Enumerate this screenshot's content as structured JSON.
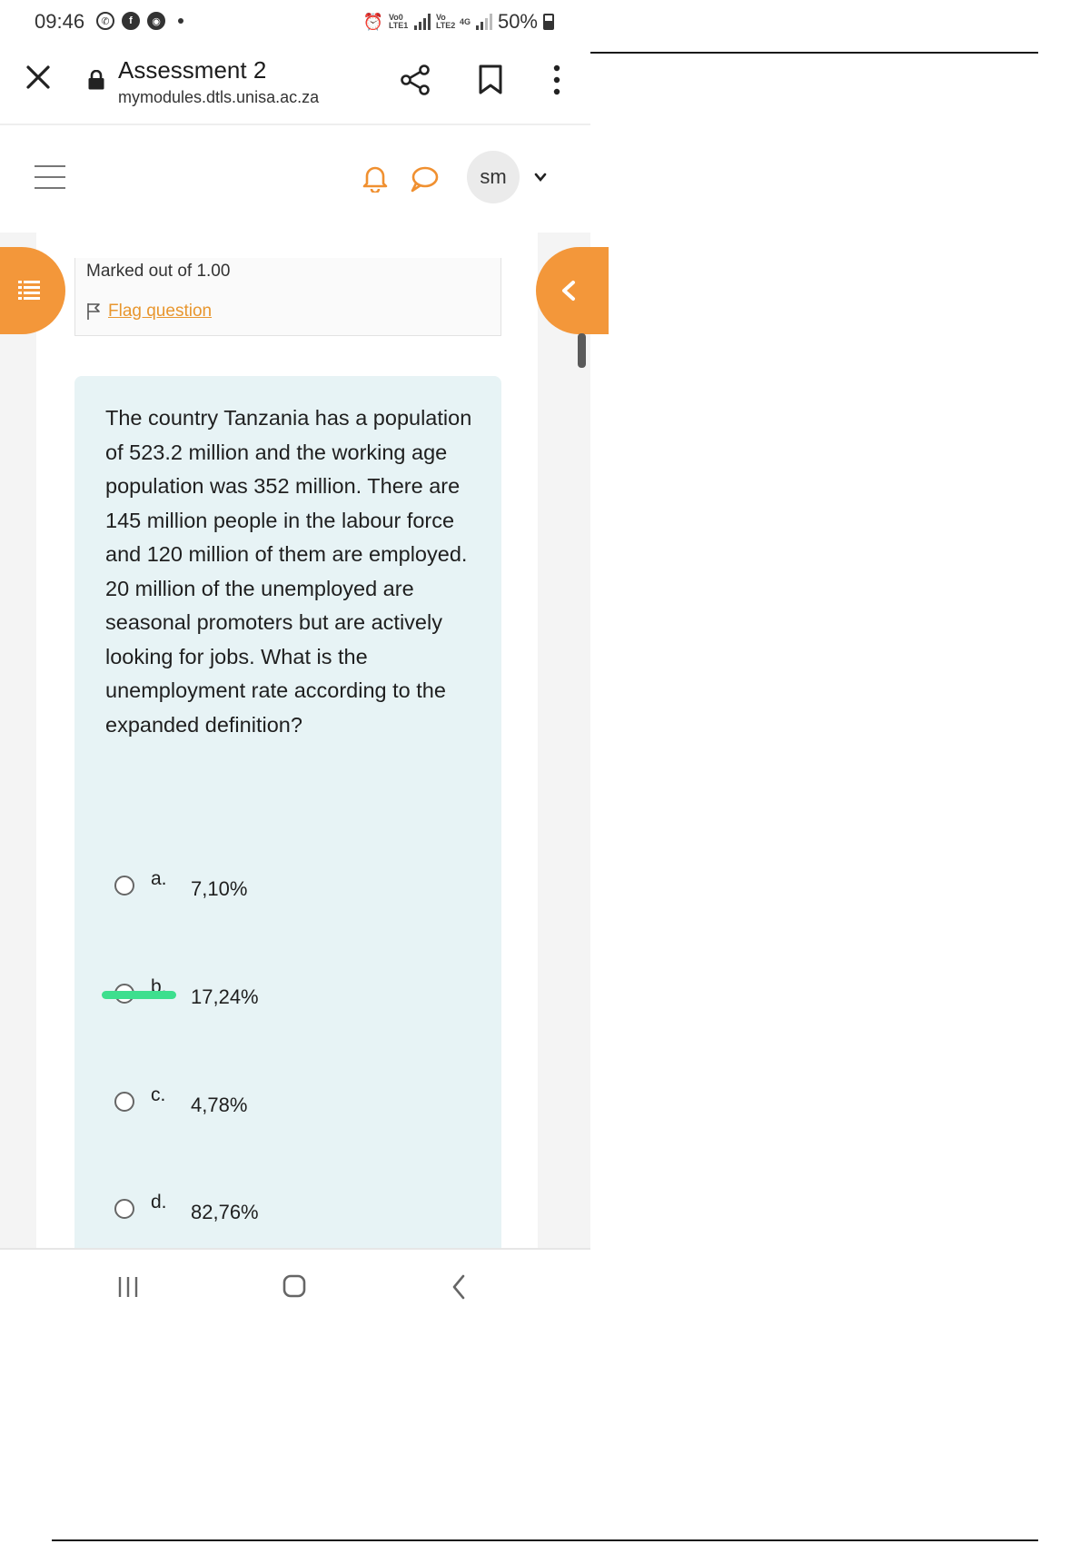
{
  "status_bar": {
    "time": "09:46",
    "battery": "50%",
    "battery_level_percent": 50,
    "signal_labels": [
      "Vo0 LTE1",
      "Vo LTE2",
      "4G"
    ]
  },
  "browser": {
    "title": "Assessment 2",
    "url": "mymodules.dtls.unisa.ac.za"
  },
  "header": {
    "avatar_initials": "sm"
  },
  "question": {
    "marked_out": "Marked out of 1.00",
    "flag_label": "Flag question",
    "text": "The country Tanzania has a population of 523.2 million and the working age population was 352 million. There are 145 million people in the labour force and 120 million of them are employed. 20 million of the unemployed are seasonal promoters but are actively looking for jobs. What is the unemployment rate according to the expanded definition?",
    "options": [
      {
        "letter": "a.",
        "text": "7,10%"
      },
      {
        "letter": "b.",
        "text": "17,24%"
      },
      {
        "letter": "c.",
        "text": "4,78%"
      },
      {
        "letter": "d.",
        "text": "82,76%"
      }
    ]
  },
  "colors": {
    "accent": "#f3973a",
    "question_bg": "#e7f3f5",
    "link": "#e8962e",
    "highlight": "#3ddf8e"
  }
}
